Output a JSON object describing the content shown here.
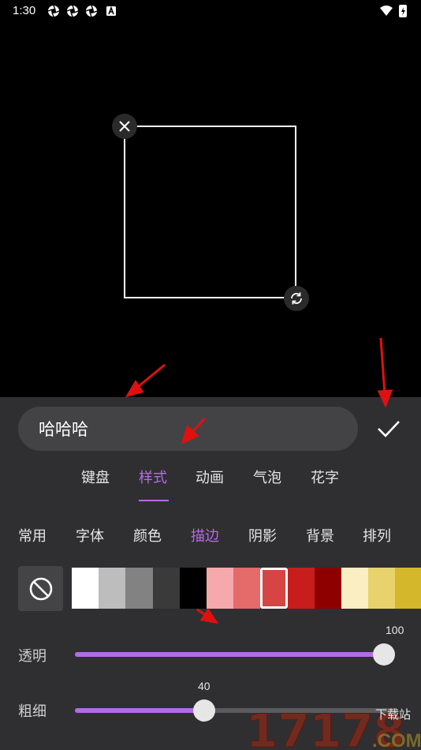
{
  "status_bar": {
    "time": "1:30",
    "icons": [
      "aperture-icon",
      "aperture-icon",
      "aperture-icon",
      "a-badge-icon"
    ],
    "right_icons": [
      "wifi-icon",
      "battery-charging-icon"
    ]
  },
  "editor": {
    "text_value": "哈哈哈"
  },
  "main_tabs": [
    {
      "label": "键盘",
      "active": false
    },
    {
      "label": "样式",
      "active": true
    },
    {
      "label": "动画",
      "active": false
    },
    {
      "label": "气泡",
      "active": false
    },
    {
      "label": "花字",
      "active": false
    }
  ],
  "sub_tabs": [
    {
      "label": "常用",
      "active": false
    },
    {
      "label": "字体",
      "active": false
    },
    {
      "label": "颜色",
      "active": false
    },
    {
      "label": "描边",
      "active": true
    },
    {
      "label": "阴影",
      "active": false
    },
    {
      "label": "背景",
      "active": false
    },
    {
      "label": "排列",
      "active": false
    }
  ],
  "swatches": [
    "#ffffff",
    "#bdbdbd",
    "#828282",
    "#3a3a3a",
    "#000000",
    "#f6a9ab",
    "#e56a6a",
    "#d64444",
    "#c81d1d",
    "#8e0000",
    "#fbeec3",
    "#e8d26b",
    "#d4b72a"
  ],
  "selected_swatch_index": 7,
  "sliders": {
    "opacity": {
      "label": "透明",
      "value": "100",
      "fraction": 1.0
    },
    "thickness": {
      "label": "粗细",
      "value": "40",
      "fraction": 0.4
    }
  },
  "colors": {
    "accent": "#b46be6",
    "panel_bg": "#2f2f31",
    "arrow": "#e01010"
  },
  "watermark": {
    "digits": "17178",
    "tagline": "下载站",
    "domain": ".COM"
  }
}
